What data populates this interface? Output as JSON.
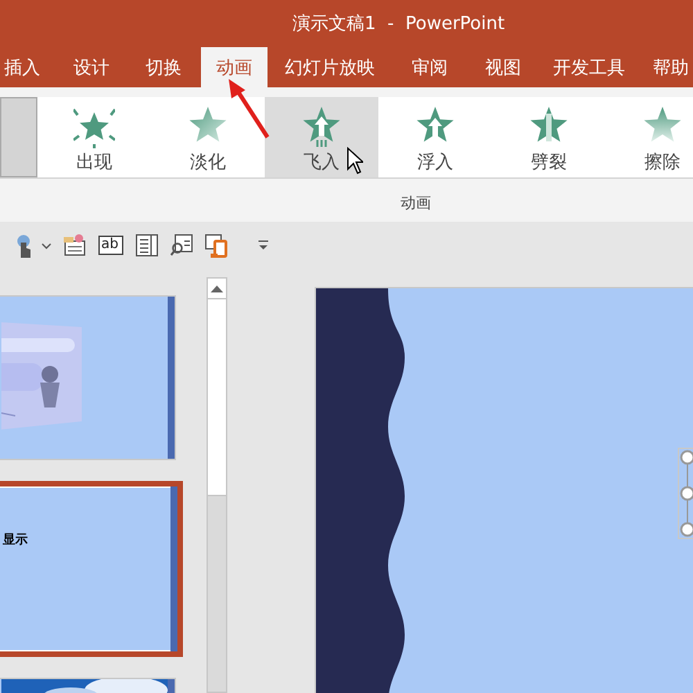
{
  "window": {
    "title": "演示文稿1  -  PowerPoint"
  },
  "tabs": [
    {
      "label": "插入",
      "selected": false
    },
    {
      "label": "设计",
      "selected": false
    },
    {
      "label": "切换",
      "selected": false
    },
    {
      "label": "动画",
      "selected": true
    },
    {
      "label": "幻灯片放映",
      "selected": false
    },
    {
      "label": "审阅",
      "selected": false
    },
    {
      "label": "视图",
      "selected": false
    },
    {
      "label": "开发工具",
      "selected": false
    },
    {
      "label": "帮助",
      "selected": false
    }
  ],
  "animations": [
    {
      "label": "出现",
      "kind": "appear",
      "selected": false
    },
    {
      "label": "淡化",
      "kind": "fade",
      "selected": false
    },
    {
      "label": "飞入",
      "kind": "fly",
      "selected": true
    },
    {
      "label": "浮入",
      "kind": "float",
      "selected": false
    },
    {
      "label": "劈裂",
      "kind": "split",
      "selected": false
    },
    {
      "label": "擦除",
      "kind": "wipe",
      "selected": false
    }
  ],
  "group_label": "动画",
  "toolbar": [
    {
      "kind": "touch"
    },
    {
      "kind": "caret"
    },
    {
      "kind": "form"
    },
    {
      "kind": "textbox",
      "text": "ab"
    },
    {
      "kind": "listbox"
    },
    {
      "kind": "preview"
    },
    {
      "kind": "device"
    },
    {
      "kind": "more"
    }
  ],
  "slides": [
    {
      "kind": "picture",
      "selected": false
    },
    {
      "kind": "text",
      "text": "显示",
      "selected": true
    },
    {
      "kind": "picture",
      "selected": false
    }
  ]
}
